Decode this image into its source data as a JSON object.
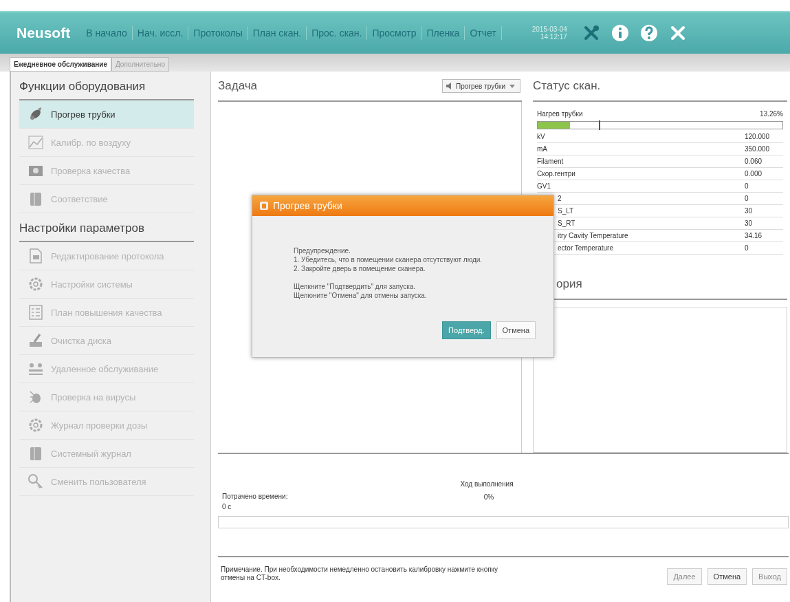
{
  "header": {
    "logo": "Neusoft",
    "nav": [
      {
        "label": "В начало",
        "selected": false
      },
      {
        "label": "Нач. иссл.",
        "selected": false
      },
      {
        "label": "Протоколы",
        "selected": false
      },
      {
        "label": "План скан.",
        "selected": false
      },
      {
        "label": "Прос. скан.",
        "selected": false
      },
      {
        "label": "Просмотр",
        "selected": false
      },
      {
        "label": "Пленка",
        "selected": false
      },
      {
        "label": "Отчет",
        "selected": false
      }
    ],
    "date": "2015-03-04",
    "time": "14:12:17",
    "tools": [
      {
        "kind": "tools"
      },
      {
        "kind": "info"
      },
      {
        "kind": "help"
      },
      {
        "kind": "close"
      }
    ]
  },
  "tabs": [
    {
      "label": "Ежедневное обслуживание",
      "selected": true
    },
    {
      "label": "Дополнительно",
      "selected": false
    }
  ],
  "sidebar": {
    "sections": [
      {
        "title": "Функции оборудования",
        "items": [
          {
            "label": "Прогрев трубки",
            "kind": "tube",
            "selected": true,
            "disabled": false
          },
          {
            "label": "Калибр. по воздуху",
            "kind": "chart",
            "selected": false,
            "disabled": true
          },
          {
            "label": "Проверка качества",
            "kind": "camera",
            "selected": false,
            "disabled": true
          },
          {
            "label": "Соответствие",
            "kind": "book",
            "selected": false,
            "disabled": true
          }
        ]
      },
      {
        "title": "Настройки параметров",
        "items": [
          {
            "label": "Редактирование протокола",
            "kind": "doc",
            "selected": false,
            "disabled": true
          },
          {
            "label": "Настройки системы",
            "kind": "gear",
            "selected": false,
            "disabled": true
          },
          {
            "label": "План повышения качества",
            "kind": "list",
            "selected": false,
            "disabled": true
          },
          {
            "label": "Очистка диска",
            "kind": "broom",
            "selected": false,
            "disabled": true
          },
          {
            "label": "Удаленное обслуживание",
            "kind": "network",
            "selected": false,
            "disabled": true
          },
          {
            "label": "Проверка на вирусы",
            "kind": "bug",
            "selected": false,
            "disabled": true
          },
          {
            "label": "Журнал проверки дозы",
            "kind": "gear",
            "selected": false,
            "disabled": true
          },
          {
            "label": "Системный журнал",
            "kind": "book",
            "selected": false,
            "disabled": true
          },
          {
            "label": "Сменить пользователя",
            "kind": "key",
            "selected": false,
            "disabled": true
          }
        ]
      }
    ]
  },
  "task": {
    "title": "Задача",
    "dropdown": "Прогрев трубки"
  },
  "status": {
    "title": "Статус скан.",
    "heat": {
      "label": "Нагрев трубки",
      "reading": "13.26%",
      "level": 0.1326
    },
    "rows": [
      {
        "label": "kV",
        "value": "120.000",
        "covered": false
      },
      {
        "label": "mA",
        "value": "350.000",
        "covered": false
      },
      {
        "label": "Filament",
        "value": "0.060",
        "covered": false
      },
      {
        "label": "Скор.гентри",
        "value": "0.000",
        "covered": false
      },
      {
        "label": "GV1",
        "value": "0",
        "covered": false
      },
      {
        "label": "2",
        "value": "0",
        "covered": true
      },
      {
        "label": "S_LT",
        "value": "30",
        "covered": true
      },
      {
        "label": "S_RT",
        "value": "30",
        "covered": true
      },
      {
        "label": "itry Cavity Temperature",
        "value": "34.16",
        "covered": true
      },
      {
        "label": "ector Temperature",
        "value": "0",
        "covered": true
      }
    ],
    "history_title": "ория"
  },
  "progress": {
    "title": "Ход выполнения",
    "reading": "0%",
    "elapsed_label": "Потрачено времени:",
    "elapsed": "0 с",
    "level": 0
  },
  "footer": {
    "note": "Примечание. При необходимости немедленно остановить калибровку нажмите кнопку отмены на CT-box.",
    "buttons": [
      {
        "label": "Далее",
        "disabled": true
      },
      {
        "label": "Отмена",
        "disabled": false
      },
      {
        "label": "Выход",
        "disabled": true
      }
    ]
  },
  "dialog": {
    "title": "Прогрев трубки",
    "paragraphs": [
      [
        "Предупреждение.",
        "1.  Убедитесь, что в помещении сканера отсутствуют люди.",
        "2.  Закройте дверь в помещение сканера."
      ],
      [
        "Щелкните \"Подтвердить\" для запуска.",
        "Щелюните \"Отмена\" для отмены запуска."
      ]
    ],
    "buttons": [
      {
        "label": "Подтверд.",
        "primary": true
      },
      {
        "label": "Отмена",
        "primary": false
      }
    ]
  }
}
